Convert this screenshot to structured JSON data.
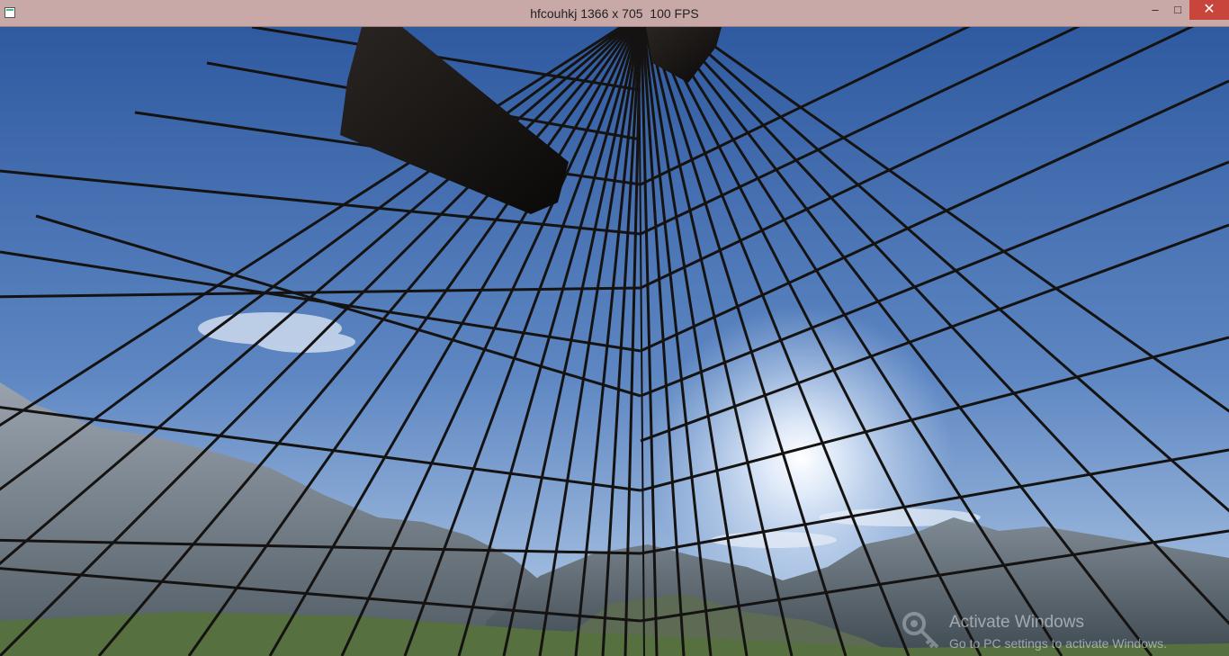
{
  "window": {
    "title": "hfcouhkj 1366 x 705  100 FPS",
    "minimize_glyph": "–",
    "maximize_glyph": "□",
    "close_glyph": "✕",
    "app_icon": "app-window-icon"
  },
  "scene": {
    "sky_top": "#3a64a8",
    "sky_horizon": "#a9c6e8",
    "mountain_color": "#6d7886",
    "grass_color": "#56703f",
    "grid_color": "#151312",
    "block_color": "#0d0b0a"
  },
  "watermark": {
    "title": "Activate Windows",
    "subtitle": "Go to PC settings to activate Windows.",
    "icon": "key-icon"
  }
}
